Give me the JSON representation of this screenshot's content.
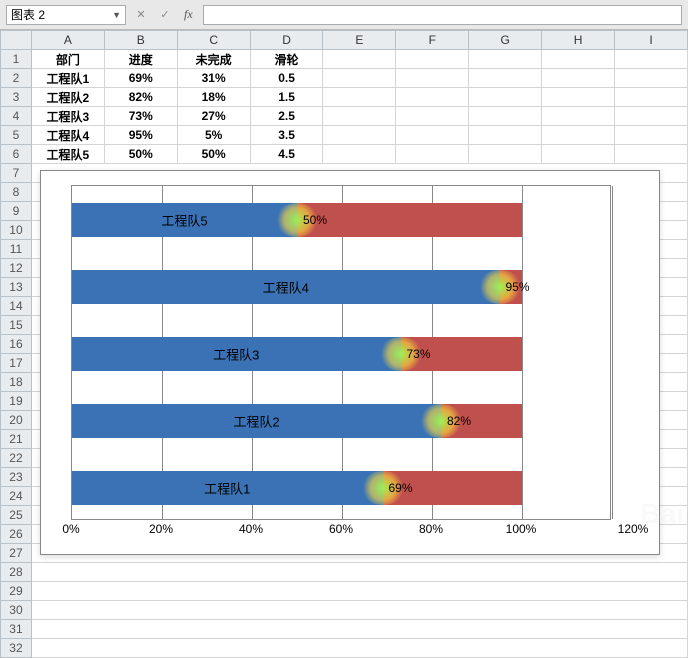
{
  "toolbar": {
    "name_box": "图表 2",
    "fx_label": "fx"
  },
  "columns": [
    "A",
    "B",
    "C",
    "D",
    "E",
    "F",
    "G",
    "H",
    "I"
  ],
  "row_numbers": [
    1,
    2,
    3,
    4,
    5,
    6,
    7,
    8,
    9,
    10,
    11,
    12,
    13,
    14,
    15,
    16,
    17,
    18,
    19,
    20,
    21,
    22,
    23,
    24,
    25,
    26,
    27,
    28,
    29,
    30,
    31,
    32
  ],
  "sheet": {
    "headers": [
      "部门",
      "进度",
      "未完成",
      "滑轮"
    ],
    "rows": [
      {
        "dept": "工程队1",
        "progress": "69%",
        "remain": "31%",
        "slider": "0.5"
      },
      {
        "dept": "工程队2",
        "progress": "82%",
        "remain": "18%",
        "slider": "1.5"
      },
      {
        "dept": "工程队3",
        "progress": "73%",
        "remain": "27%",
        "slider": "2.5"
      },
      {
        "dept": "工程队4",
        "progress": "95%",
        "remain": "5%",
        "slider": "3.5"
      },
      {
        "dept": "工程队5",
        "progress": "50%",
        "remain": "50%",
        "slider": "4.5"
      }
    ]
  },
  "chart_data": {
    "type": "bar",
    "orientation": "horizontal",
    "stacked": true,
    "categories": [
      "工程队5",
      "工程队4",
      "工程队3",
      "工程队2",
      "工程队1"
    ],
    "series": [
      {
        "name": "进度",
        "values": [
          50,
          95,
          73,
          82,
          69
        ],
        "color": "#3a72b5"
      },
      {
        "name": "未完成",
        "values": [
          50,
          5,
          27,
          18,
          31
        ],
        "color": "#c0504d"
      }
    ],
    "xlim": [
      0,
      120
    ],
    "xticks": [
      0,
      20,
      40,
      60,
      80,
      100,
      120
    ],
    "xticks_labels": [
      "0%",
      "20%",
      "40%",
      "60%",
      "80%",
      "100%",
      "120%"
    ],
    "data_labels": [
      "50%",
      "95%",
      "73%",
      "82%",
      "69%"
    ]
  }
}
